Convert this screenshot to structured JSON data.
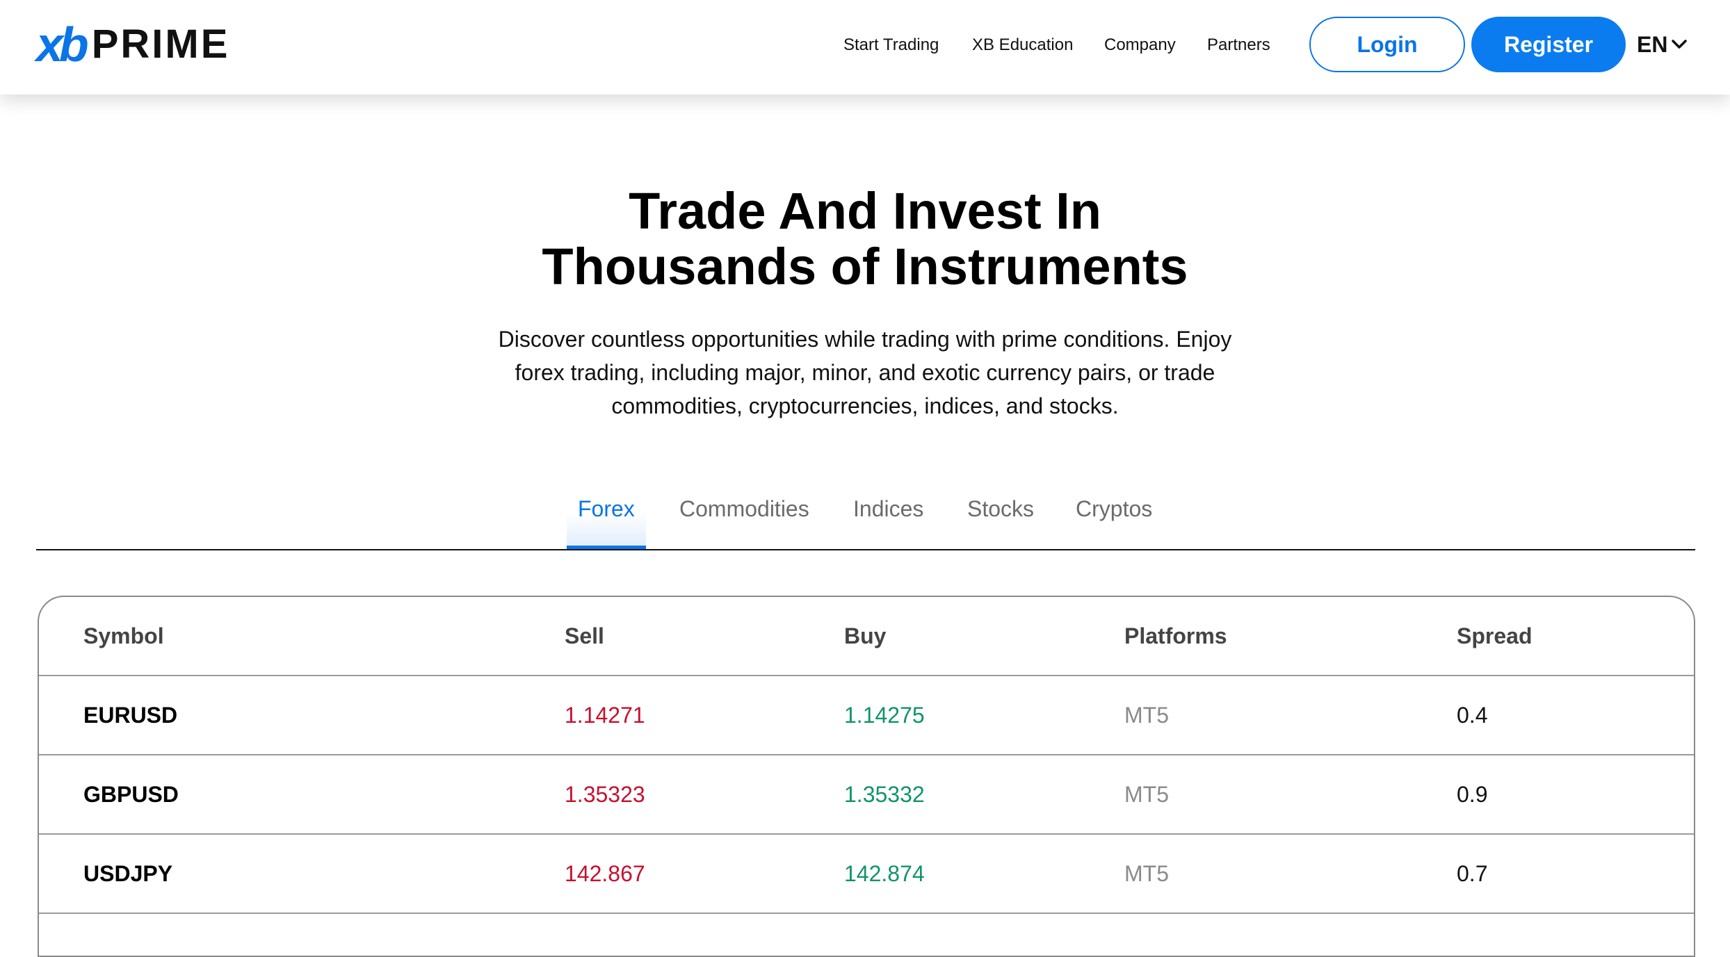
{
  "brand": {
    "logo_xb": "xb",
    "logo_prime": "PRIME",
    "accent": "#0a74e8"
  },
  "nav": {
    "items": [
      "Start Trading",
      "XB Education",
      "Company",
      "Partners"
    ],
    "login_label": "Login",
    "register_label": "Register",
    "lang_label": "EN"
  },
  "hero": {
    "title_line1": "Trade And Invest In",
    "title_line2": "Thousands of Instruments",
    "subtitle_line1": "Discover countless opportunities while trading with prime conditions. Enjoy",
    "subtitle_line2": "forex trading, including major, minor, and exotic currency pairs, or trade",
    "subtitle_line3": "commodities, cryptocurrencies, indices, and stocks."
  },
  "tabs": [
    "Forex",
    "Commodities",
    "Indices",
    "Stocks",
    "Cryptos"
  ],
  "active_tab": "Forex",
  "table": {
    "headers": [
      "Symbol",
      "Sell",
      "Buy",
      "Platforms",
      "Spread"
    ],
    "rows": [
      {
        "symbol": "EURUSD",
        "sell": "1.14271",
        "buy": "1.14275",
        "platform": "MT5",
        "spread": "0.4"
      },
      {
        "symbol": "GBPUSD",
        "sell": "1.35323",
        "buy": "1.35332",
        "platform": "MT5",
        "spread": "0.9"
      },
      {
        "symbol": "USDJPY",
        "sell": "142.867",
        "buy": "142.874",
        "platform": "MT5",
        "spread": "0.7"
      }
    ],
    "colors": {
      "sell": "#c8102e",
      "buy": "#11946a"
    }
  }
}
